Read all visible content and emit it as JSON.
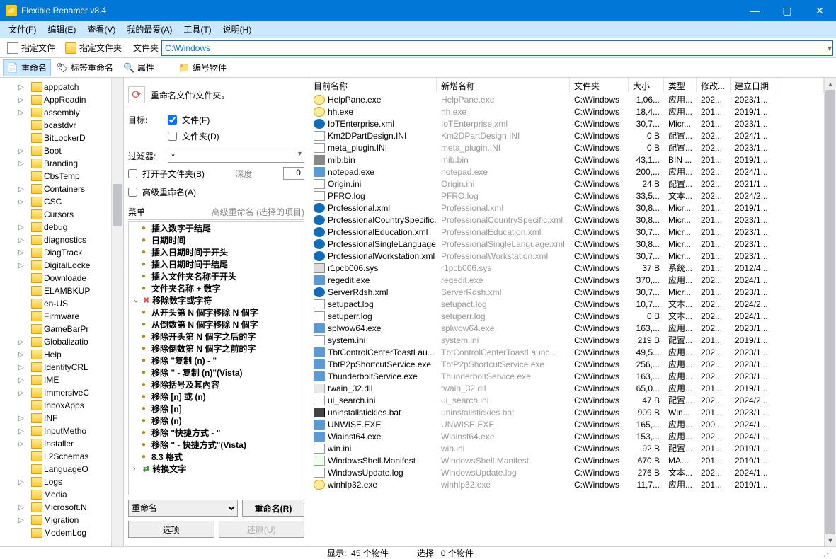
{
  "window": {
    "title": "Flexible Renamer v8.4"
  },
  "menu": [
    "文件(F)",
    "编辑(E)",
    "查看(V)",
    "我的最爱(A)",
    "工具(T)",
    "说明(H)"
  ],
  "toolbar1": {
    "spec_file": "指定文件",
    "spec_folder": "指定文件夹",
    "path_label": "文件夹",
    "path_value": "C:\\Windows"
  },
  "toolbar2": {
    "rename": "重命名",
    "tag_rename": "标签重命名",
    "attrs": "属性",
    "number_objs": "编号物件"
  },
  "tree": [
    {
      "n": "apppatch",
      "e": 1
    },
    {
      "n": "AppReadin",
      "e": 1
    },
    {
      "n": "assembly",
      "e": 1
    },
    {
      "n": "bcastdvr",
      "e": 0
    },
    {
      "n": "BitLockerD",
      "e": 0
    },
    {
      "n": "Boot",
      "e": 1
    },
    {
      "n": "Branding",
      "e": 1
    },
    {
      "n": "CbsTemp",
      "e": 0
    },
    {
      "n": "Containers",
      "e": 1
    },
    {
      "n": "CSC",
      "e": 1
    },
    {
      "n": "Cursors",
      "e": 0
    },
    {
      "n": "debug",
      "e": 1
    },
    {
      "n": "diagnostics",
      "e": 1
    },
    {
      "n": "DiagTrack",
      "e": 1
    },
    {
      "n": "DigitalLocke",
      "e": 1
    },
    {
      "n": "Downloade",
      "e": 0
    },
    {
      "n": "ELAMBKUP",
      "e": 0
    },
    {
      "n": "en-US",
      "e": 0
    },
    {
      "n": "Firmware",
      "e": 0
    },
    {
      "n": "GameBarPr",
      "e": 0
    },
    {
      "n": "Globalizatio",
      "e": 1
    },
    {
      "n": "Help",
      "e": 1
    },
    {
      "n": "IdentityCRL",
      "e": 1
    },
    {
      "n": "IME",
      "e": 1
    },
    {
      "n": "ImmersiveC",
      "e": 1
    },
    {
      "n": "InboxApps",
      "e": 0
    },
    {
      "n": "INF",
      "e": 1
    },
    {
      "n": "InputMetho",
      "e": 1
    },
    {
      "n": "Installer",
      "e": 1
    },
    {
      "n": "L2Schemas",
      "e": 0
    },
    {
      "n": "LanguageO",
      "e": 0
    },
    {
      "n": "Logs",
      "e": 1
    },
    {
      "n": "Media",
      "e": 0
    },
    {
      "n": "Microsoft.N",
      "e": 1
    },
    {
      "n": "Migration",
      "e": 1
    },
    {
      "n": "ModemLog",
      "e": 0
    }
  ],
  "options": {
    "header": "重命名文件/文件夹。",
    "target_label": "目标:",
    "chk_file": "文件(F)",
    "chk_folder": "文件夹(D)",
    "filter_label": "过滤器:",
    "filter_value": "*",
    "open_sub": "打开子文件夹(B)",
    "depth_label": "深度",
    "depth_value": "0",
    "adv_rename": "高级重命名(A)",
    "menu_left": "菜单",
    "menu_right": "高级重命名 (选择的项目)",
    "dropdown": "重命名",
    "btn_rename": "重命名(R)",
    "btn_options": "选项",
    "btn_restore": "还原(U)"
  },
  "rules": [
    {
      "t": "插入数字于结尾",
      "k": "b"
    },
    {
      "t": "日期时间",
      "k": "b"
    },
    {
      "t": "插入日期时间于开头",
      "k": "b"
    },
    {
      "t": "插入日期时间于结尾",
      "k": "b"
    },
    {
      "t": "插入文件夹名称于开头",
      "k": "b"
    },
    {
      "t": "文件夹名称 + 数字",
      "k": "b"
    },
    {
      "t": "移除数字或字符",
      "k": "gx"
    },
    {
      "t": "从开头第 N 個字移除 N 個字",
      "k": "b"
    },
    {
      "t": "从倒数第 N 個字移除 N 個字",
      "k": "b"
    },
    {
      "t": "移除开头第 N 個字之后的字",
      "k": "b"
    },
    {
      "t": "移除倒数第 N 個字之前的字",
      "k": "b"
    },
    {
      "t": "移除 \"复制 (n) - \"",
      "k": "b"
    },
    {
      "t": "移除 \" - 复制 (n)\"(Vista)",
      "k": "b"
    },
    {
      "t": "移除括号及其內容",
      "k": "b"
    },
    {
      "t": "移除 [n] 或 (n)",
      "k": "b"
    },
    {
      "t": "移除 [n]",
      "k": "b"
    },
    {
      "t": "移除 (n)",
      "k": "b"
    },
    {
      "t": "移除 \"快捷方式 - \"",
      "k": "b"
    },
    {
      "t": "移除 \" - 快捷方式\"(Vista)",
      "k": "b"
    },
    {
      "t": "8.3 格式",
      "k": "b"
    },
    {
      "t": "转换文字",
      "k": "ga"
    }
  ],
  "file_headers": [
    "目前名称",
    "新增名称",
    "文件夹",
    "大小",
    "类型",
    "修改...",
    "建立日期"
  ],
  "files": [
    {
      "ic": "help",
      "n": "HelpPane.exe",
      "fold": "C:\\Windows",
      "sz": "1,06...",
      "ty": "应用...",
      "mod": "202...",
      "dt": "2023/1..."
    },
    {
      "ic": "help",
      "n": "hh.exe",
      "fold": "C:\\Windows",
      "sz": "18,4...",
      "ty": "应用...",
      "mod": "201...",
      "dt": "2019/1..."
    },
    {
      "ic": "edge",
      "n": "IoTEnterprise.xml",
      "fold": "C:\\Windows",
      "sz": "30,7...",
      "ty": "Micr...",
      "mod": "201...",
      "dt": "2023/1..."
    },
    {
      "ic": "ini",
      "n": "Km2DPartDesign.INI",
      "fold": "C:\\Windows",
      "sz": "0 B",
      "ty": "配置...",
      "mod": "202...",
      "dt": "2024/1..."
    },
    {
      "ic": "ini",
      "n": "meta_plugin.INI",
      "fold": "C:\\Windows",
      "sz": "0 B",
      "ty": "配置...",
      "mod": "202...",
      "dt": "2023/1..."
    },
    {
      "ic": "bin",
      "n": "mib.bin",
      "fold": "C:\\Windows",
      "sz": "43,1...",
      "ty": "BIN ...",
      "mod": "201...",
      "dt": "2019/1..."
    },
    {
      "ic": "exe",
      "n": "notepad.exe",
      "fold": "C:\\Windows",
      "sz": "200,...",
      "ty": "应用...",
      "mod": "202...",
      "dt": "2024/1..."
    },
    {
      "ic": "ini",
      "n": "Origin.ini",
      "fold": "C:\\Windows",
      "sz": "24 B",
      "ty": "配置...",
      "mod": "202...",
      "dt": "2021/1..."
    },
    {
      "ic": "log",
      "n": "PFRO.log",
      "fold": "C:\\Windows",
      "sz": "33,5...",
      "ty": "文本...",
      "mod": "202...",
      "dt": "2024/2..."
    },
    {
      "ic": "edge",
      "n": "Professional.xml",
      "fold": "C:\\Windows",
      "sz": "30,8...",
      "ty": "Micr...",
      "mod": "201...",
      "dt": "2019/1..."
    },
    {
      "ic": "edge",
      "n": "ProfessionalCountrySpecific...",
      "nn": "ProfessionalCountrySpecific.xml",
      "fold": "C:\\Windows",
      "sz": "30,8...",
      "ty": "Micr...",
      "mod": "201...",
      "dt": "2023/1..."
    },
    {
      "ic": "edge",
      "n": "ProfessionalEducation.xml",
      "fold": "C:\\Windows",
      "sz": "30,7...",
      "ty": "Micr...",
      "mod": "201...",
      "dt": "2023/1..."
    },
    {
      "ic": "edge",
      "n": "ProfessionalSingleLanguage...",
      "nn": "ProfessionalSingleLanguage.xml",
      "fold": "C:\\Windows",
      "sz": "30,8...",
      "ty": "Micr...",
      "mod": "201...",
      "dt": "2023/1..."
    },
    {
      "ic": "edge",
      "n": "ProfessionalWorkstation.xml",
      "fold": "C:\\Windows",
      "sz": "30,7...",
      "ty": "Micr...",
      "mod": "201...",
      "dt": "2023/1..."
    },
    {
      "ic": "sys",
      "n": "r1pcb006.sys",
      "fold": "C:\\Windows",
      "sz": "37 B",
      "ty": "系统...",
      "mod": "201...",
      "dt": "2012/4..."
    },
    {
      "ic": "exe",
      "n": "regedit.exe",
      "fold": "C:\\Windows",
      "sz": "370,...",
      "ty": "应用...",
      "mod": "202...",
      "dt": "2024/1..."
    },
    {
      "ic": "edge",
      "n": "ServerRdsh.xml",
      "fold": "C:\\Windows",
      "sz": "30,7...",
      "ty": "Micr...",
      "mod": "201...",
      "dt": "2023/1..."
    },
    {
      "ic": "log",
      "n": "setupact.log",
      "fold": "C:\\Windows",
      "sz": "10,7...",
      "ty": "文本...",
      "mod": "202...",
      "dt": "2024/2..."
    },
    {
      "ic": "log",
      "n": "setuperr.log",
      "fold": "C:\\Windows",
      "sz": "0 B",
      "ty": "文本...",
      "mod": "202...",
      "dt": "2024/1..."
    },
    {
      "ic": "exe",
      "n": "splwow64.exe",
      "fold": "C:\\Windows",
      "sz": "163,...",
      "ty": "应用...",
      "mod": "202...",
      "dt": "2023/1..."
    },
    {
      "ic": "ini",
      "n": "system.ini",
      "fold": "C:\\Windows",
      "sz": "219 B",
      "ty": "配置...",
      "mod": "201...",
      "dt": "2019/1..."
    },
    {
      "ic": "exe",
      "n": "TbtControlCenterToastLau...",
      "nn": "TbtControlCenterToastLaunc...",
      "fold": "C:\\Windows",
      "sz": "49,5...",
      "ty": "应用...",
      "mod": "202...",
      "dt": "2023/1..."
    },
    {
      "ic": "exe",
      "n": "TbtP2pShortcutService.exe",
      "fold": "C:\\Windows",
      "sz": "256,...",
      "ty": "应用...",
      "mod": "202...",
      "dt": "2023/1..."
    },
    {
      "ic": "exe",
      "n": "ThunderboltService.exe",
      "fold": "C:\\Windows",
      "sz": "163,...",
      "ty": "应用...",
      "mod": "202...",
      "dt": "2023/1..."
    },
    {
      "ic": "dll",
      "n": "twain_32.dll",
      "fold": "C:\\Windows",
      "sz": "65,0...",
      "ty": "应用...",
      "mod": "201...",
      "dt": "2019/1..."
    },
    {
      "ic": "ini",
      "n": "ui_search.ini",
      "fold": "C:\\Windows",
      "sz": "47 B",
      "ty": "配置...",
      "mod": "202...",
      "dt": "2024/2..."
    },
    {
      "ic": "bat",
      "n": "uninstallstickies.bat",
      "fold": "C:\\Windows",
      "sz": "909 B",
      "ty": "Win...",
      "mod": "201...",
      "dt": "2023/1..."
    },
    {
      "ic": "exe",
      "n": "UNWISE.EXE",
      "fold": "C:\\Windows",
      "sz": "165,...",
      "ty": "应用...",
      "mod": "200...",
      "dt": "2024/1..."
    },
    {
      "ic": "exe",
      "n": "Wiainst64.exe",
      "fold": "C:\\Windows",
      "sz": "153,...",
      "ty": "应用...",
      "mod": "202...",
      "dt": "2024/1..."
    },
    {
      "ic": "ini",
      "n": "win.ini",
      "fold": "C:\\Windows",
      "sz": "92 B",
      "ty": "配置...",
      "mod": "201...",
      "dt": "2019/1..."
    },
    {
      "ic": "man",
      "n": "WindowsShell.Manifest",
      "fold": "C:\\Windows",
      "sz": "670 B",
      "ty": "MAN...",
      "mod": "201...",
      "dt": "2019/1..."
    },
    {
      "ic": "log",
      "n": "WindowsUpdate.log",
      "fold": "C:\\Windows",
      "sz": "276 B",
      "ty": "文本...",
      "mod": "202...",
      "dt": "2024/1..."
    },
    {
      "ic": "help",
      "n": "winhlp32.exe",
      "fold": "C:\\Windows",
      "sz": "11,7...",
      "ty": "应用...",
      "mod": "201...",
      "dt": "2019/1..."
    }
  ],
  "status": {
    "show_label": "显示:",
    "show_value": "45 个物件",
    "sel_label": "选择:",
    "sel_value": "0 个物件"
  }
}
